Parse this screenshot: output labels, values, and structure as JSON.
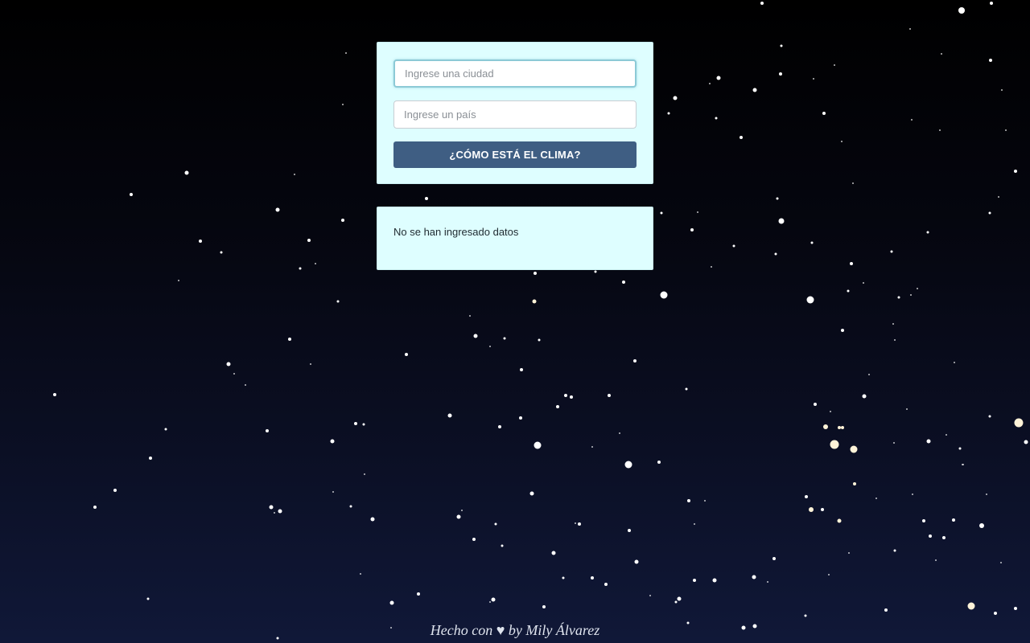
{
  "form": {
    "city_placeholder": "Ingrese una ciudad",
    "country_placeholder": "Ingrese un país",
    "submit_label": "¿CÓMO ESTÁ EL CLIMA?"
  },
  "result": {
    "message": "No se han ingresado datos"
  },
  "footer": {
    "prefix": "Hecho con",
    "heart": "♥",
    "suffix": "by Mily Álvarez"
  },
  "colors": {
    "card_background": "#defeff",
    "button_background": "#3f5e83",
    "sky_top": "#000000",
    "sky_bottom": "#101838"
  }
}
